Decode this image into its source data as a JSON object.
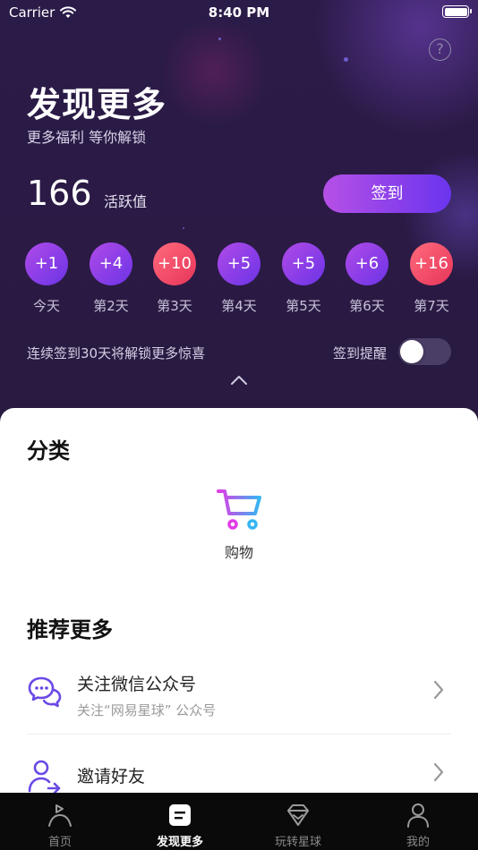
{
  "status_bar": {
    "carrier": "Carrier",
    "time": "8:40 PM"
  },
  "header": {
    "help_symbol": "?",
    "title": "发现更多",
    "subtitle": "更多福利 等你解锁"
  },
  "activity": {
    "score": "166",
    "score_label": "活跃值",
    "signin_label": "签到"
  },
  "checkin_days": [
    {
      "bonus": "+1",
      "label": "今天",
      "style": "purple"
    },
    {
      "bonus": "+4",
      "label": "第2天",
      "style": "purple"
    },
    {
      "bonus": "+10",
      "label": "第3天",
      "style": "red"
    },
    {
      "bonus": "+5",
      "label": "第4天",
      "style": "purple"
    },
    {
      "bonus": "+5",
      "label": "第5天",
      "style": "purple"
    },
    {
      "bonus": "+6",
      "label": "第6天",
      "style": "purple"
    },
    {
      "bonus": "+16",
      "label": "第7天",
      "style": "red"
    }
  ],
  "streak_text": "连续签到30天将解锁更多惊喜",
  "reminder": {
    "label": "签到提醒",
    "enabled": false
  },
  "categories": {
    "title": "分类",
    "items": [
      {
        "label": "购物",
        "icon": "shopping-cart-icon"
      }
    ]
  },
  "recommend": {
    "title": "推荐更多",
    "items": [
      {
        "title": "关注微信公众号",
        "subtitle": "关注“网易星球” 公众号",
        "icon": "wechat-icon"
      },
      {
        "title": "邀请好友",
        "subtitle": "",
        "icon": "invite-user-icon"
      }
    ]
  },
  "tabbar": {
    "items": [
      {
        "label": "首页",
        "icon": "home-flag-icon",
        "active": false
      },
      {
        "label": "发现更多",
        "icon": "discover-icon",
        "active": true
      },
      {
        "label": "玩转星球",
        "icon": "diamond-icon",
        "active": false
      },
      {
        "label": "我的",
        "icon": "profile-icon",
        "active": false
      }
    ]
  },
  "colors": {
    "hero_bg": "#2b1b48",
    "accent_purple": "#6a34ee",
    "accent_red": "#e7355a",
    "tabbar_bg": "#0a0a0a"
  }
}
